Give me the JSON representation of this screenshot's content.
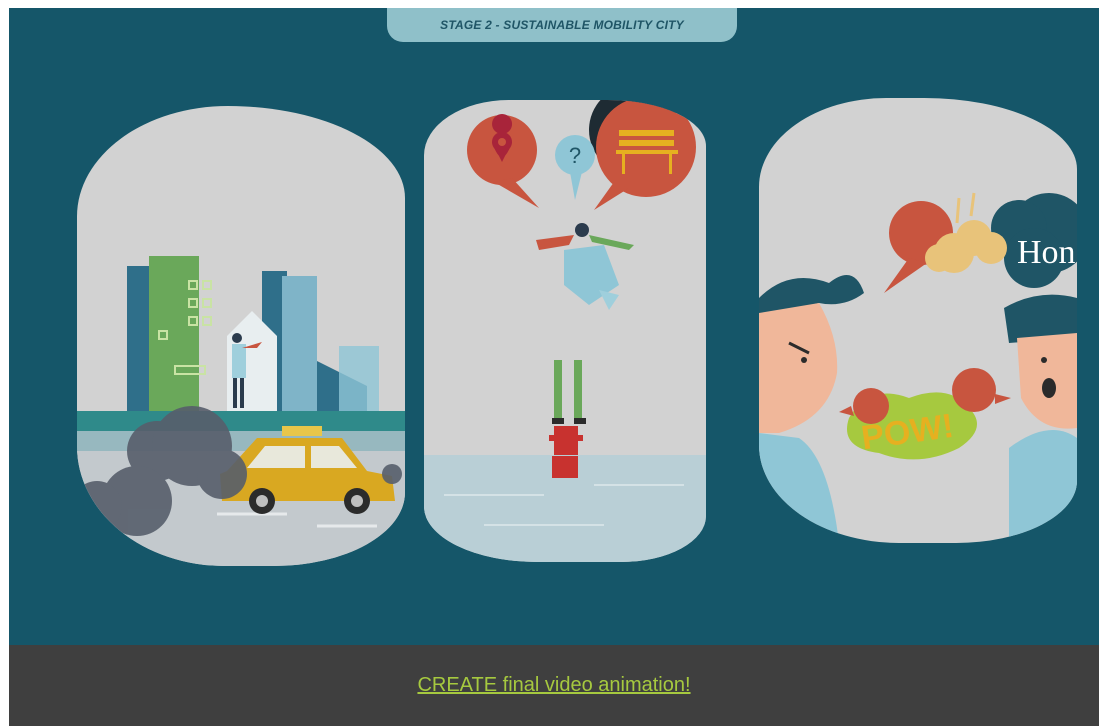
{
  "video": {
    "stage_title": "STAGE 2 - SUSTAINABLE MOBILITY CITY",
    "panels": [
      {
        "scene": "city-traffic-pollution"
      },
      {
        "scene": "confused-commuter"
      },
      {
        "scene": "argument"
      }
    ],
    "comic_text": {
      "horn": "Hon",
      "pow": "POW!"
    }
  },
  "footer": {
    "link_text": " CREATE final video animation!"
  },
  "colors": {
    "frame_bg": "#155669",
    "panel_bg": "#d2d2d2",
    "speech_red": "#c8553f",
    "link_green": "#a6c93f",
    "footer_bg": "#3f3f3f",
    "taxi_yellow": "#d9a821"
  }
}
